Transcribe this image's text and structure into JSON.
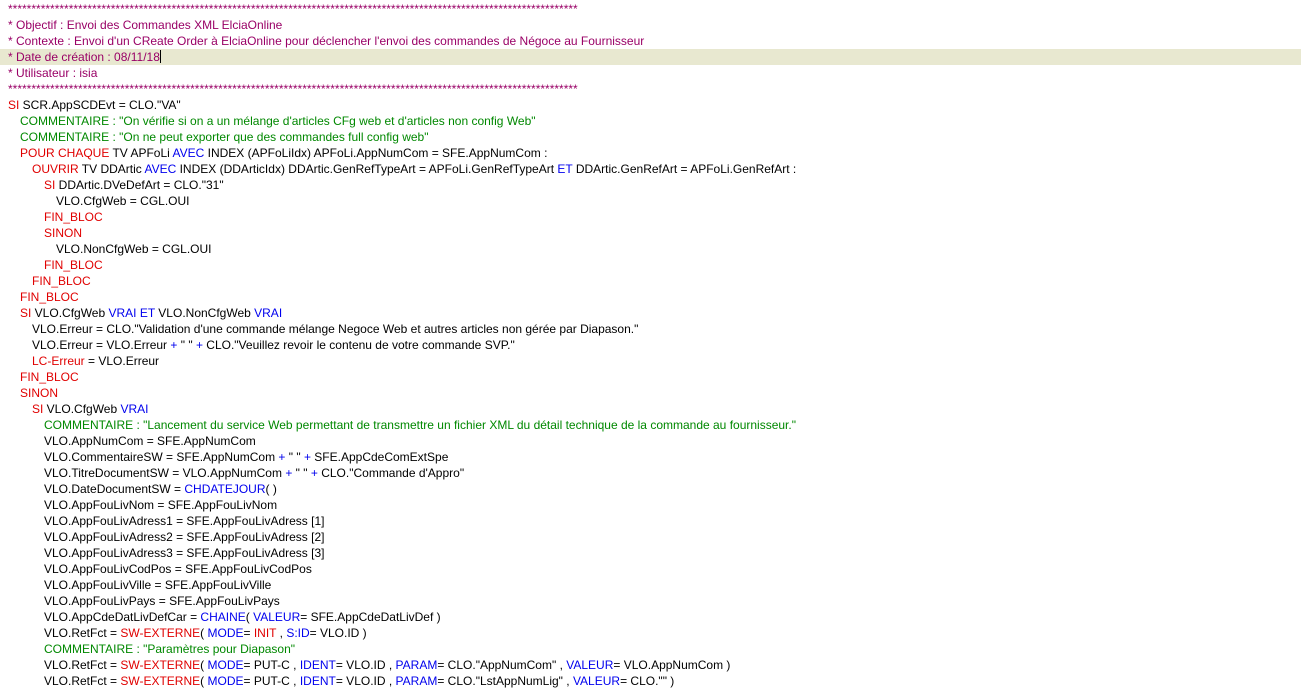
{
  "editor": {
    "current_line": 3,
    "lines": [
      {
        "indent": 0,
        "segs": [
          [
            "hdr",
            "**************************************************************************************************************************"
          ]
        ]
      },
      {
        "indent": 0,
        "segs": [
          [
            "hdr",
            "* Objectif : Envoi des Commandes XML ElciaOnline"
          ]
        ]
      },
      {
        "indent": 0,
        "segs": [
          [
            "hdr",
            "* Contexte : Envoi d'un CReate Order à ElciaOnline pour déclencher l'envoi des commandes de Négoce au Fournisseur"
          ]
        ]
      },
      {
        "indent": 0,
        "segs": [
          [
            "hdr",
            "* Date de création : 08/11/18"
          ]
        ]
      },
      {
        "indent": 0,
        "segs": [
          [
            "hdr",
            "* Utilisateur : isia"
          ]
        ]
      },
      {
        "indent": 0,
        "segs": [
          [
            "hdr",
            "**************************************************************************************************************************"
          ]
        ]
      },
      {
        "indent": 0,
        "segs": [
          [
            "kw",
            "SI"
          ],
          [
            "txt",
            " SCR.AppSCDEvt = CLO.\"VA\""
          ]
        ]
      },
      {
        "indent": 1,
        "segs": [
          [
            "cmt",
            "COMMENTAIRE : \"On vérifie si on a un mélange d'articles CFg web et d'articles non config Web\""
          ]
        ]
      },
      {
        "indent": 1,
        "segs": [
          [
            "cmt",
            "COMMENTAIRE : \"On ne peut exporter que des commandes full config web\""
          ]
        ]
      },
      {
        "indent": 1,
        "segs": [
          [
            "kw",
            "POUR CHAQUE"
          ],
          [
            "txt",
            " TV APFoLi "
          ],
          [
            "blue",
            "AVEC"
          ],
          [
            "txt",
            " INDEX (APFoLiIdx) APFoLi.AppNumCom = SFE.AppNumCom :"
          ]
        ]
      },
      {
        "indent": 2,
        "segs": [
          [
            "kw",
            "OUVRIR"
          ],
          [
            "txt",
            " TV DDArtic "
          ],
          [
            "blue",
            "AVEC"
          ],
          [
            "txt",
            " INDEX (DDArticIdx) DDArtic.GenRefTypeArt = APFoLi.GenRefTypeArt "
          ],
          [
            "blue",
            "ET"
          ],
          [
            "txt",
            " DDArtic.GenRefArt = APFoLi.GenRefArt :"
          ]
        ]
      },
      {
        "indent": 3,
        "segs": [
          [
            "kw",
            "SI"
          ],
          [
            "txt",
            " DDArtic.DVeDefArt = CLO.\"31\""
          ]
        ]
      },
      {
        "indent": 4,
        "segs": [
          [
            "txt",
            "VLO.CfgWeb = CGL.OUI"
          ]
        ]
      },
      {
        "indent": 3,
        "segs": [
          [
            "kw",
            "FIN_BLOC"
          ]
        ]
      },
      {
        "indent": 3,
        "segs": [
          [
            "kw",
            "SINON"
          ]
        ]
      },
      {
        "indent": 4,
        "segs": [
          [
            "txt",
            "VLO.NonCfgWeb = CGL.OUI"
          ]
        ]
      },
      {
        "indent": 3,
        "segs": [
          [
            "kw",
            "FIN_BLOC"
          ]
        ]
      },
      {
        "indent": 2,
        "segs": [
          [
            "kw",
            "FIN_BLOC"
          ]
        ]
      },
      {
        "indent": 1,
        "segs": [
          [
            "kw",
            "FIN_BLOC"
          ]
        ]
      },
      {
        "indent": 1,
        "segs": [
          [
            "kw",
            "SI"
          ],
          [
            "txt",
            " VLO.CfgWeb "
          ],
          [
            "blue",
            "VRAI ET"
          ],
          [
            "txt",
            " VLO.NonCfgWeb "
          ],
          [
            "blue",
            "VRAI"
          ]
        ]
      },
      {
        "indent": 2,
        "segs": [
          [
            "txt",
            "VLO.Erreur = CLO.\"Validation d'une commande mélange Negoce Web et autres articles non gérée par Diapason.\""
          ]
        ]
      },
      {
        "indent": 2,
        "segs": [
          [
            "txt",
            "VLO.Erreur = VLO.Erreur "
          ],
          [
            "blue",
            "+"
          ],
          [
            "txt",
            " \" \" "
          ],
          [
            "blue",
            "+"
          ],
          [
            "txt",
            " CLO.\"Veuillez revoir le contenu de votre commande SVP.\""
          ]
        ]
      },
      {
        "indent": 2,
        "segs": [
          [
            "kw",
            "LC-Erreur"
          ],
          [
            "txt",
            " = VLO.Erreur"
          ]
        ]
      },
      {
        "indent": 1,
        "segs": [
          [
            "kw",
            "FIN_BLOC"
          ]
        ]
      },
      {
        "indent": 1,
        "segs": [
          [
            "kw",
            "SINON"
          ]
        ]
      },
      {
        "indent": 2,
        "segs": [
          [
            "kw",
            "SI"
          ],
          [
            "txt",
            " VLO.CfgWeb "
          ],
          [
            "blue",
            "VRAI"
          ]
        ]
      },
      {
        "indent": 3,
        "segs": [
          [
            "cmt",
            "COMMENTAIRE : \"Lancement du service Web permettant de transmettre un fichier XML du détail technique de la commande au fournisseur.\""
          ]
        ]
      },
      {
        "indent": 3,
        "segs": [
          [
            "txt",
            "VLO.AppNumCom = SFE.AppNumCom"
          ]
        ]
      },
      {
        "indent": 3,
        "segs": [
          [
            "txt",
            "VLO.CommentaireSW = SFE.AppNumCom "
          ],
          [
            "blue",
            "+"
          ],
          [
            "txt",
            " \" \" "
          ],
          [
            "blue",
            "+"
          ],
          [
            "txt",
            " SFE.AppCdeComExtSpe"
          ]
        ]
      },
      {
        "indent": 3,
        "segs": [
          [
            "txt",
            "VLO.TitreDocumentSW = VLO.AppNumCom "
          ],
          [
            "blue",
            "+"
          ],
          [
            "txt",
            " \" \" "
          ],
          [
            "blue",
            "+"
          ],
          [
            "txt",
            " CLO.\"Commande d'Appro\""
          ]
        ]
      },
      {
        "indent": 3,
        "segs": [
          [
            "txt",
            "VLO.DateDocumentSW = "
          ],
          [
            "blue",
            "CHDATEJOUR"
          ],
          [
            "txt",
            "( )"
          ]
        ]
      },
      {
        "indent": 3,
        "segs": [
          [
            "txt",
            "VLO.AppFouLivNom = SFE.AppFouLivNom"
          ]
        ]
      },
      {
        "indent": 3,
        "segs": [
          [
            "txt",
            "VLO.AppFouLivAdress1 = SFE.AppFouLivAdress [1]"
          ]
        ]
      },
      {
        "indent": 3,
        "segs": [
          [
            "txt",
            "VLO.AppFouLivAdress2 = SFE.AppFouLivAdress [2]"
          ]
        ]
      },
      {
        "indent": 3,
        "segs": [
          [
            "txt",
            "VLO.AppFouLivAdress3 = SFE.AppFouLivAdress [3]"
          ]
        ]
      },
      {
        "indent": 3,
        "segs": [
          [
            "txt",
            "VLO.AppFouLivCodPos = SFE.AppFouLivCodPos"
          ]
        ]
      },
      {
        "indent": 3,
        "segs": [
          [
            "txt",
            "VLO.AppFouLivVille = SFE.AppFouLivVille"
          ]
        ]
      },
      {
        "indent": 3,
        "segs": [
          [
            "txt",
            "VLO.AppFouLivPays = SFE.AppFouLivPays"
          ]
        ]
      },
      {
        "indent": 3,
        "segs": [
          [
            "txt",
            "VLO.AppCdeDatLivDefCar = "
          ],
          [
            "blue",
            "CHAINE"
          ],
          [
            "txt",
            "( "
          ],
          [
            "blue",
            "VALEUR"
          ],
          [
            "txt",
            "= SFE.AppCdeDatLivDef )"
          ]
        ]
      },
      {
        "indent": 3,
        "segs": [
          [
            "txt",
            "VLO.RetFct = "
          ],
          [
            "kw",
            "SW-EXTERNE"
          ],
          [
            "txt",
            "( "
          ],
          [
            "blue",
            "MODE"
          ],
          [
            "txt",
            "= "
          ],
          [
            "kw",
            "INIT"
          ],
          [
            "txt",
            " , "
          ],
          [
            "blue",
            "S:ID"
          ],
          [
            "txt",
            "= VLO.ID )"
          ]
        ]
      },
      {
        "indent": 3,
        "segs": [
          [
            "cmt",
            "COMMENTAIRE : \"Paramètres pour Diapason\""
          ]
        ]
      },
      {
        "indent": 3,
        "segs": [
          [
            "txt",
            "VLO.RetFct = "
          ],
          [
            "kw",
            "SW-EXTERNE"
          ],
          [
            "txt",
            "( "
          ],
          [
            "blue",
            "MODE"
          ],
          [
            "txt",
            "= PUT-C , "
          ],
          [
            "blue",
            "IDENT"
          ],
          [
            "txt",
            "= VLO.ID , "
          ],
          [
            "blue",
            "PARAM"
          ],
          [
            "txt",
            "= CLO.\"AppNumCom\" , "
          ],
          [
            "blue",
            "VALEUR"
          ],
          [
            "txt",
            "= VLO.AppNumCom )"
          ]
        ]
      },
      {
        "indent": 3,
        "segs": [
          [
            "txt",
            "VLO.RetFct = "
          ],
          [
            "kw",
            "SW-EXTERNE"
          ],
          [
            "txt",
            "( "
          ],
          [
            "blue",
            "MODE"
          ],
          [
            "txt",
            "= PUT-C , "
          ],
          [
            "blue",
            "IDENT"
          ],
          [
            "txt",
            "= VLO.ID , "
          ],
          [
            "blue",
            "PARAM"
          ],
          [
            "txt",
            "= CLO.\"LstAppNumLig\" , "
          ],
          [
            "blue",
            "VALEUR"
          ],
          [
            "txt",
            "= CLO.\"\" )"
          ]
        ]
      }
    ]
  }
}
